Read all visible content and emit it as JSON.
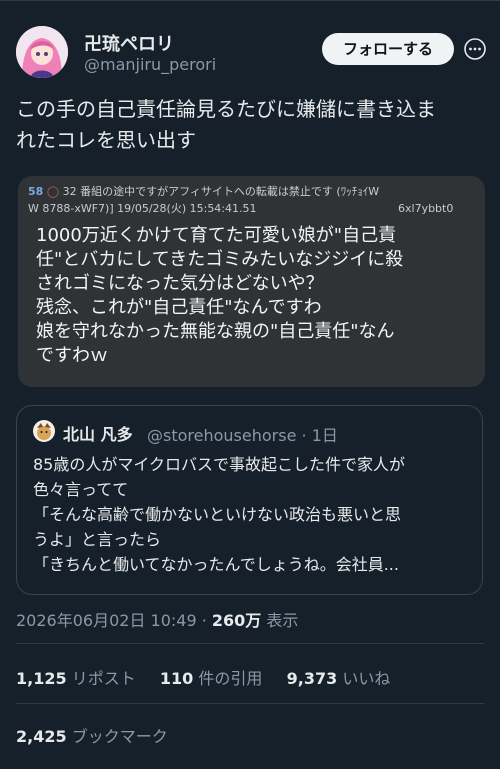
{
  "author": {
    "display_name": "卍琉ペロリ",
    "handle": "@manjiru_perori"
  },
  "follow_button": "フォローする",
  "tweet": {
    "text_line1": "この手の自己責任論見るたびに嫌儲に書き込ま",
    "text_line2": "れたコレを思い出す"
  },
  "image_post": {
    "number": "58",
    "reply_count": "32",
    "notice": "番組の途中ですがアフィサイトへの転載は禁止です",
    "name_suffix": "(ﾜｯﾁｮｲW",
    "meta_line": "W 8788-xWF7)] 19/05/28(火) 15:54:41.51",
    "post_id": "6xl7ybbt0",
    "body_lines": [
      "1000万近くかけて育てた可愛い娘が\"自己責",
      "任\"とバカにしてきたゴミみたいなジジイに殺",
      "されゴミになった気分はどないや？",
      "残念、これが\"自己責任\"なんですわ",
      "娘を守れなかった無能な親の\"自己責任\"なん",
      "ですわｗ"
    ]
  },
  "quoted_tweet": {
    "display_name": "北山 凡多",
    "handle": "@storehousehorse",
    "time": "1日",
    "lines": [
      "85歳の人がマイクロバスで事故起こした件で家人が",
      "色々言ってて",
      "「そんな高齢で働かないといけない政治も悪いと思",
      "うよ」と言ったら",
      "「きちんと働いてなかったんでしょうね。会社員..."
    ]
  },
  "meta": {
    "timestamp": "2026年06月02日 10:49",
    "views_count": "260万",
    "views_label": "表示"
  },
  "stats": {
    "reposts_count": "1,125",
    "reposts_label": "リポスト",
    "quotes_count": "110",
    "quotes_label": "件の引用",
    "likes_count": "9,373",
    "likes_label": "いいね",
    "bookmarks_count": "2,425",
    "bookmarks_label": "ブックマーク"
  },
  "colors": {
    "background": "#15202b",
    "text": "#e7e9ea",
    "muted": "#8b98a5",
    "image_background": "#2f3336"
  }
}
